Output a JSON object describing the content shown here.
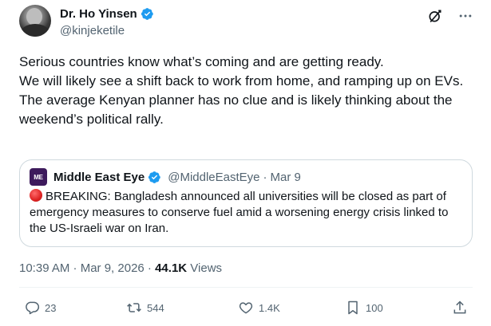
{
  "author": {
    "display_name": "Dr. Ho Yinsen",
    "handle": "@kinjeketile"
  },
  "tweet": {
    "lines": [
      "Serious countries know what’s coming and are getting ready.",
      "We will likely see a shift back to work from home, and ramping up on EVs.",
      "The average Kenyan planner has no clue and is likely thinking about the weekend’s political rally."
    ]
  },
  "quote": {
    "logo_text": "ME",
    "name": "Middle East Eye",
    "handle": "@MiddleEastEye",
    "separator": "·",
    "date": "Mar 9",
    "text": "BREAKING: Bangladesh announced all universities will be closed as part of emergency measures to conserve fuel amid a worsening energy crisis linked to the US-Israeli war on Iran."
  },
  "meta": {
    "timestamp": "10:39 AM · Mar 9, 2026 · ",
    "views_count": "44.1K",
    "views_label": " Views"
  },
  "actions": {
    "replies": "23",
    "reposts": "544",
    "likes": "1.4K",
    "bookmarks": "100"
  },
  "colors": {
    "verified_blue": "#1d9bf0",
    "text_primary": "#0f1419",
    "text_secondary": "#536471",
    "border": "#cfd9de",
    "quote_logo_bg": "#3d1a5c",
    "breaking_dot": "#dd2222"
  },
  "icons": {
    "top": [
      "grok-icon",
      "more-icon"
    ],
    "actions": [
      "reply-icon",
      "retweet-icon",
      "like-icon",
      "bookmark-icon",
      "share-icon"
    ]
  }
}
